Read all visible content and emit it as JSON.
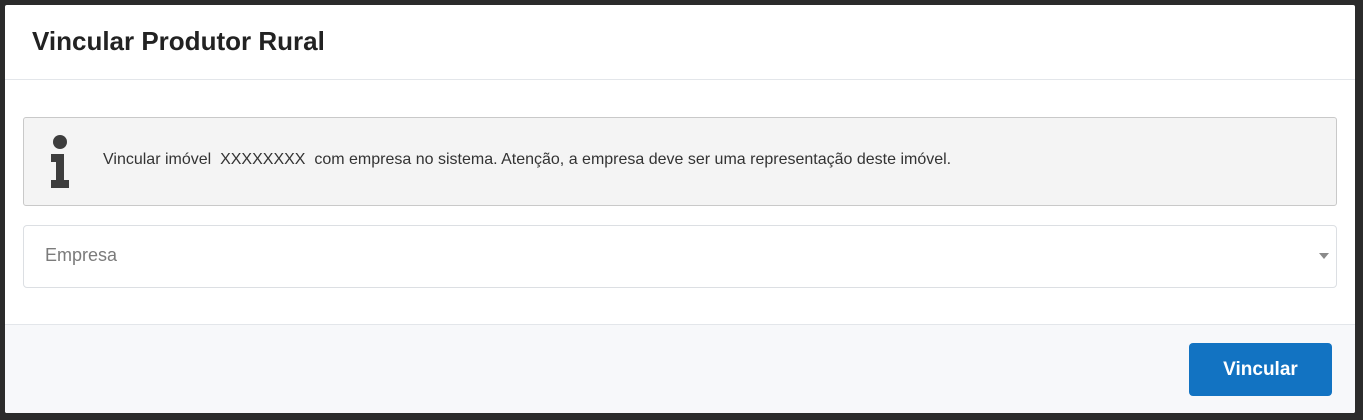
{
  "modal": {
    "title": "Vincular Produtor Rural"
  },
  "alert": {
    "icon": "info-icon",
    "text": "Vincular imóvel  XXXXXXXX  com empresa no sistema. Atenção, a empresa deve ser uma representação deste imóvel."
  },
  "form": {
    "empresa_select": {
      "placeholder": "Empresa",
      "value": ""
    }
  },
  "footer": {
    "submit_label": "Vincular"
  },
  "colors": {
    "primary": "#1273c2",
    "alert_bg": "#f4f4f4",
    "footer_bg": "#f7f8fa"
  }
}
